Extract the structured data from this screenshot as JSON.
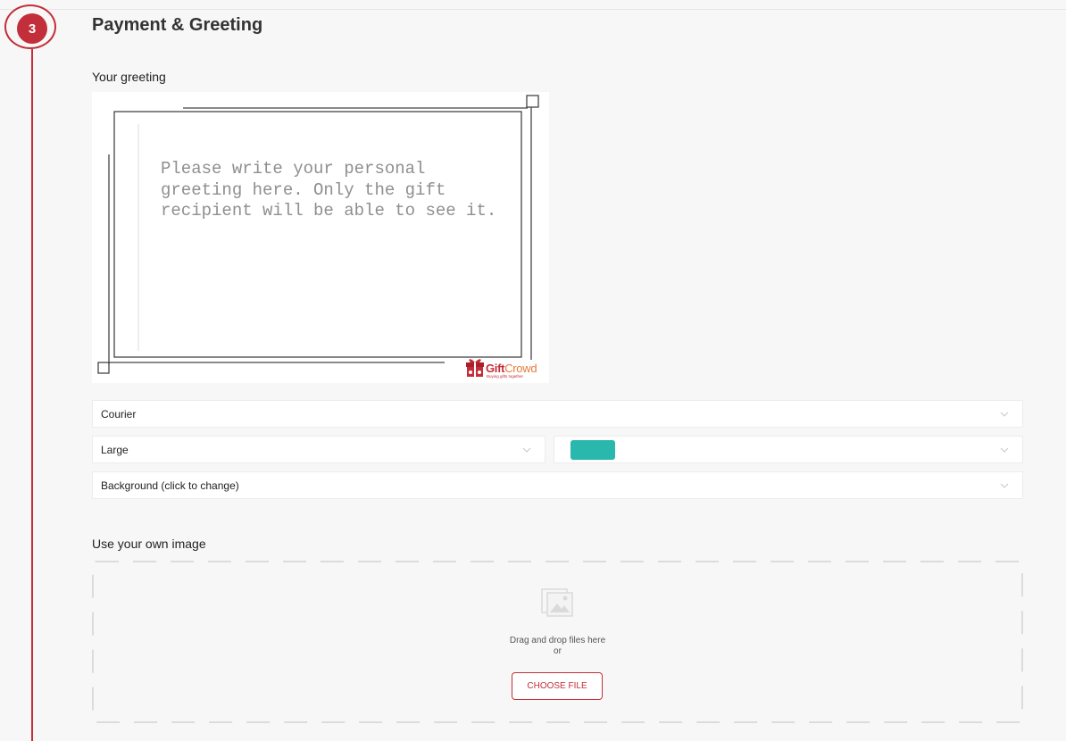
{
  "step": {
    "number": "3",
    "title": "Payment & Greeting"
  },
  "greeting": {
    "label": "Your greeting",
    "placeholder": "Please write your personal greeting here. Only the gift recipient will be able to see it."
  },
  "logo": {
    "text": "GiftCrowd",
    "tagline": "Buying gifts together"
  },
  "controls": {
    "font": {
      "value": "Courier"
    },
    "size": {
      "value": "Large"
    },
    "color": {
      "value": "#2ab7ae"
    },
    "background": {
      "value": "Background (click to change)"
    }
  },
  "upload": {
    "label": "Use your own image",
    "drag_text": "Drag and drop files here",
    "or_text": "or",
    "button_label": "CHOOSE FILE"
  },
  "colors": {
    "accent": "#c22f3a",
    "teal": "#2ab7ae"
  }
}
